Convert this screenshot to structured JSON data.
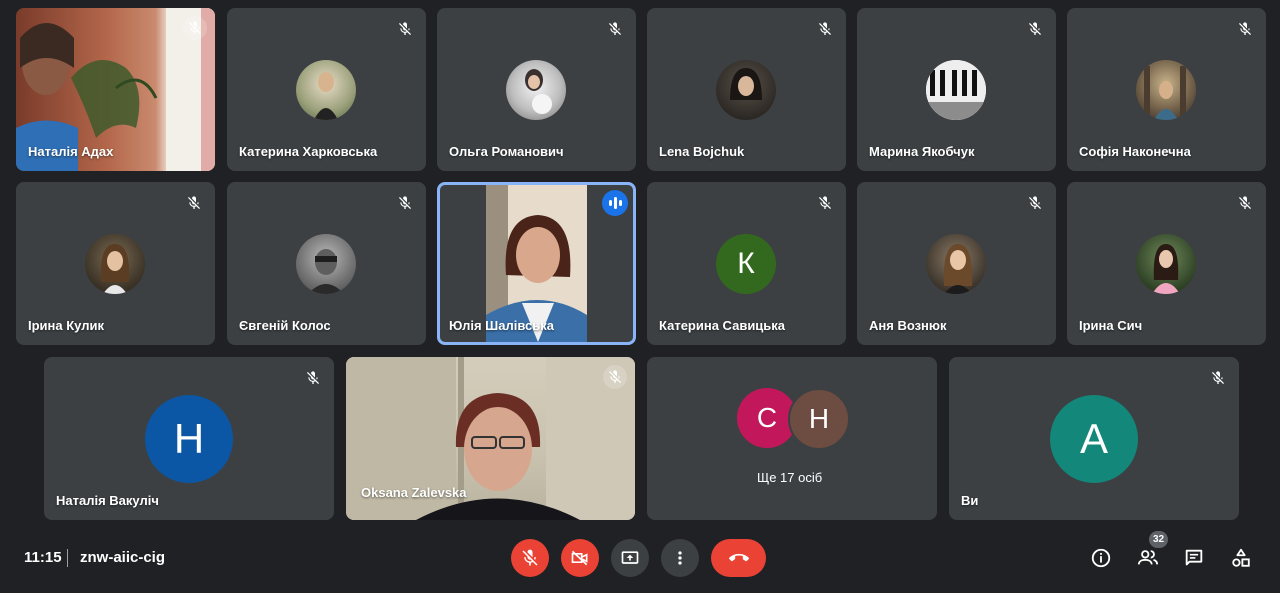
{
  "meeting": {
    "time": "11:15",
    "code": "znw-aiic-cig",
    "participants_count": "32"
  },
  "tiles": {
    "natalia_adakh": "Наталія Адах",
    "kateryna_kharkovska": "Катерина Харковська",
    "olha_romanovych": "Ольга Романович",
    "lena_bojchuk": "Lena Bojchuk",
    "maryna_yakobchuk": "Марина Якобчук",
    "sofia_nakonechna": "Софія Наконечна",
    "iryna_kulyk": "Ірина Кулик",
    "yevhenii_kolos": "Євгеній Колос",
    "yulia_shalivska": "Юлія Шалівська",
    "kateryna_savytska": "Катерина Савицька",
    "kateryna_savytska_initial": "К",
    "ania_vozniuk": "Аня Вознюк",
    "iryna_sych": "Ірина Сич",
    "natalia_vakulich": "Наталія Вакуліч",
    "natalia_vakulich_initial": "Н",
    "oksana_zalevska": "Oksana Zalevska",
    "more_initial_1": "С",
    "more_initial_2": "Н",
    "more_label": "Ще 17 осіб",
    "self_name": "Ви",
    "self_initial": "А"
  },
  "colors": {
    "background": "#202124",
    "tile": "#3c4043",
    "active_border": "#8ab4f8",
    "red_control": "#ea4335",
    "avatar_k": "#33691e",
    "avatar_n_blue": "#0b57a5",
    "avatar_c": "#c2185b",
    "avatar_n_brown": "#6d4c41",
    "avatar_a": "#12877a"
  },
  "controls": {
    "mic": "mic-off-icon",
    "camera": "camera-off-icon",
    "present": "present-screen-icon",
    "more": "more-vert-icon",
    "leave": "call-end-icon",
    "info": "info-icon",
    "people": "people-icon",
    "chat": "chat-icon",
    "activities": "activities-icon"
  }
}
